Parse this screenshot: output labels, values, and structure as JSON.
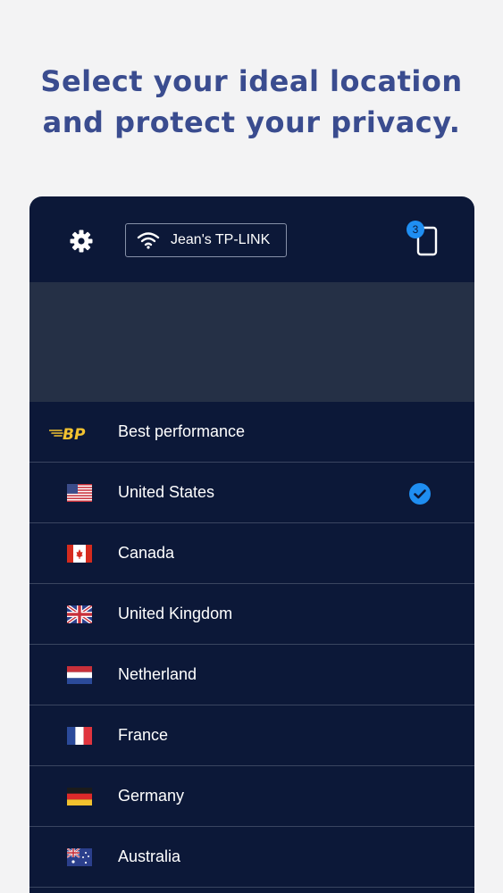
{
  "headline": {
    "line1": "Select your ideal location",
    "line2": "and protect your privacy."
  },
  "topbar": {
    "settings_icon": "gear-icon",
    "wifi_icon": "wifi-icon",
    "network_name": "Jean's TP-LINK",
    "device_icon": "phone-icon",
    "device_count": "3"
  },
  "locations": [
    {
      "label": "Best performance",
      "icon": "best-performance-logo",
      "selected": false
    },
    {
      "label": "United States",
      "icon": "us-flag",
      "selected": true
    },
    {
      "label": "Canada",
      "icon": "canada-flag",
      "selected": false
    },
    {
      "label": "United Kingdom",
      "icon": "uk-flag",
      "selected": false
    },
    {
      "label": "Netherland",
      "icon": "netherlands-flag",
      "selected": false
    },
    {
      "label": "France",
      "icon": "france-flag",
      "selected": false
    },
    {
      "label": "Germany",
      "icon": "germany-flag",
      "selected": false
    },
    {
      "label": "Australia",
      "icon": "australia-flag",
      "selected": false
    }
  ],
  "colors": {
    "page_bg": "#f3f3f4",
    "headline": "#3a4c8f",
    "panel_bg": "#0c1838",
    "map_bg": "#253046",
    "accent": "#1f8ef1",
    "bp_logo": "#f2c230"
  }
}
